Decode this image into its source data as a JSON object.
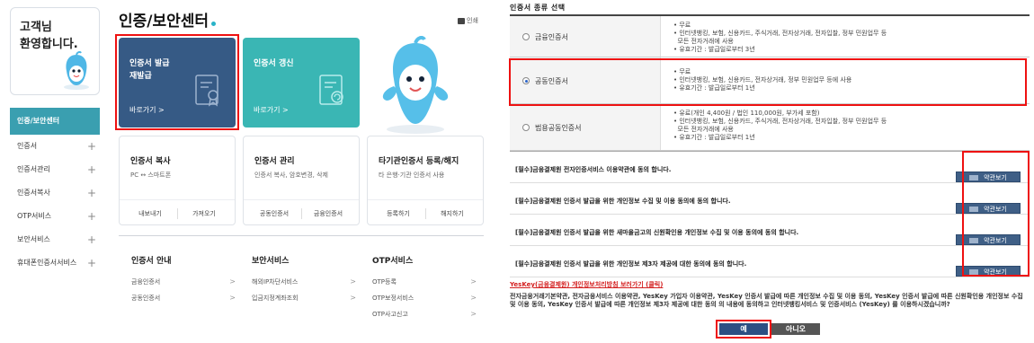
{
  "left": {
    "greeting_line1": "고객님",
    "greeting_line2": "환영합니다.",
    "page_title": "인증/보안센터",
    "print_label": "인쇄",
    "sidebar": {
      "active": "인증/보안센터",
      "items": [
        {
          "label": "인증서"
        },
        {
          "label": "인증서관리"
        },
        {
          "label": "인증서복사"
        },
        {
          "label": "OTP서비스"
        },
        {
          "label": "보안서비스"
        },
        {
          "label": "휴대폰인증서서비스"
        }
      ]
    },
    "big_cards": [
      {
        "title_line1": "인증서 발급",
        "title_line2": "재발급",
        "link": "바로가기 >"
      },
      {
        "title_line1": "인증서 갱신",
        "title_line2": "",
        "link": "바로가기 >"
      }
    ],
    "small_cards": [
      {
        "title": "인증서 복사",
        "desc": "PC ↔ 스마트폰",
        "btn1": "내보내기",
        "btn2": "가져오기"
      },
      {
        "title": "인증서 관리",
        "desc": "인증서 복사, 암호변경, 삭제",
        "btn1": "공동인증서",
        "btn2": "금융인증서"
      },
      {
        "title": "타기관인증서 등록/해지",
        "desc": "타 은행·기관 인증서 사용",
        "btn1": "등록하기",
        "btn2": "해지하기"
      }
    ],
    "bottom_columns": [
      {
        "title": "인증서 안내",
        "items": [
          "금융인증서",
          "공동인증서"
        ]
      },
      {
        "title": "보안서비스",
        "items": [
          "해외IP차단서비스",
          "입금지정계좌조회"
        ]
      },
      {
        "title": "OTP서비스",
        "items": [
          "OTP등록",
          "OTP보정서비스",
          "OTP사고신고"
        ]
      }
    ]
  },
  "right": {
    "section_title": "인증서 종류 선택",
    "cert_types": [
      {
        "label": "금융인증서",
        "selected": false,
        "desc": [
          "• 무료",
          "• 인터넷뱅킹, 보험, 신용카드, 주식거래, 전자상거래, 전자입찰, 정부 민원업무 등",
          "  모든 전자거래에 사용",
          "• 유효기간 : 발급일로부터 3년"
        ]
      },
      {
        "label": "공동인증서",
        "selected": true,
        "desc": [
          "• 무료",
          "• 인터넷뱅킹, 보험, 신용카드, 전자상거래, 정부 민원업무 등에 사용",
          "• 유효기간 : 발급일로부터 1년"
        ]
      },
      {
        "label": "범용공동인증서",
        "selected": false,
        "desc": [
          "• 유료(개인 4,400원 / 법인 110,000원, 부가세 포함)",
          "• 인터넷뱅킹, 보험, 신용카드, 주식거래, 전자상거래, 전자입찰, 정부 민원업무 등",
          "  모든 전자거래에 사용",
          "• 유효기간 : 발급일로부터 1년"
        ]
      }
    ],
    "agreements": [
      {
        "text": "[필수]금융결제원 전자인증서비스 이용약관에 동의 합니다.",
        "button": "약관보기"
      },
      {
        "text": "[필수]금융결제원 인증서 발급을 위한 개인정보 수집 및 이용 동의에 동의 합니다.",
        "button": "약관보기"
      },
      {
        "text": "[필수]금융결제원 인증서 발급을 위한 새마을금고의 신원확인용 개인정보 수집 및 이용 동의에 동의 합니다.",
        "button": "약관보기"
      },
      {
        "text": "[필수]금융결제원 인증서 발급을 위한 개인정보 제3자 제공에 대한 동의에 동의 합니다.",
        "button": "약관보기"
      }
    ],
    "yeskey_link": "YesKey(금융결제원) 개인정보처리방침 보러가기 (클릭)",
    "consent_text": "전자금융거래기본약관, 전자금융서비스 이용약관, YesKey 가입자 이용약관, YesKey 인증서 발급에 따른 개인정보 수집 및 이용 동의, YesKey 인증서 발급에 따른 신원확인용 개인정보 수집 및 이용 동의, YesKey 인증서 발급에 따른 개인정보 제3자 제공에 대한 동의 의 내용에 동의하고 인터넷뱅킹서비스 및 인증서비스 (YesKey) 를 이용하시겠습니까?",
    "yes_label": "예",
    "no_label": "아니오"
  },
  "colors": {
    "navy_card": "#365a85",
    "teal_card": "#3ab6b4",
    "sidebar_active": "#3a9fb0",
    "highlight": "#e11111",
    "button_blue": "#2c4f83"
  }
}
